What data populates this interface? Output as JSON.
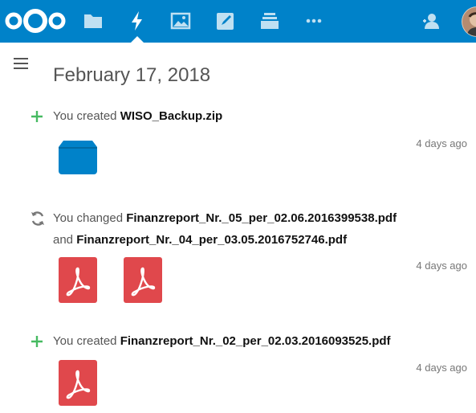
{
  "nav": {
    "items": [
      {
        "name": "files",
        "icon": "folder-icon"
      },
      {
        "name": "activity",
        "icon": "lightning-icon",
        "active": true
      },
      {
        "name": "gallery",
        "icon": "image-icon"
      },
      {
        "name": "notes",
        "icon": "pencil-icon"
      },
      {
        "name": "deck",
        "icon": "stack-icon"
      },
      {
        "name": "more",
        "icon": "more-icon"
      }
    ],
    "contacts_icon": "contacts-icon",
    "brand_color": "#0082c9"
  },
  "date_heading": "February 17, 2018",
  "activities": [
    {
      "icon": "plus-icon",
      "prefix": "You created ",
      "file1": "WISO_Backup.zip",
      "time": "4 days ago",
      "thumbs": [
        "zip-icon"
      ]
    },
    {
      "icon": "refresh-icon",
      "prefix": "You changed ",
      "file1": "Finanzreport_Nr._05_per_02.06.2016399538.pdf",
      "joiner": "and ",
      "file2": "Finanzreport_Nr._04_per_03.05.2016752746.pdf",
      "time": "4 days ago",
      "thumbs": [
        "pdf-icon",
        "pdf-icon"
      ]
    },
    {
      "icon": "plus-icon",
      "prefix": "You created ",
      "file1": "Finanzreport_Nr._02_per_02.03.2016093525.pdf",
      "time": "4 days ago",
      "thumbs": [
        "pdf-icon"
      ]
    }
  ]
}
